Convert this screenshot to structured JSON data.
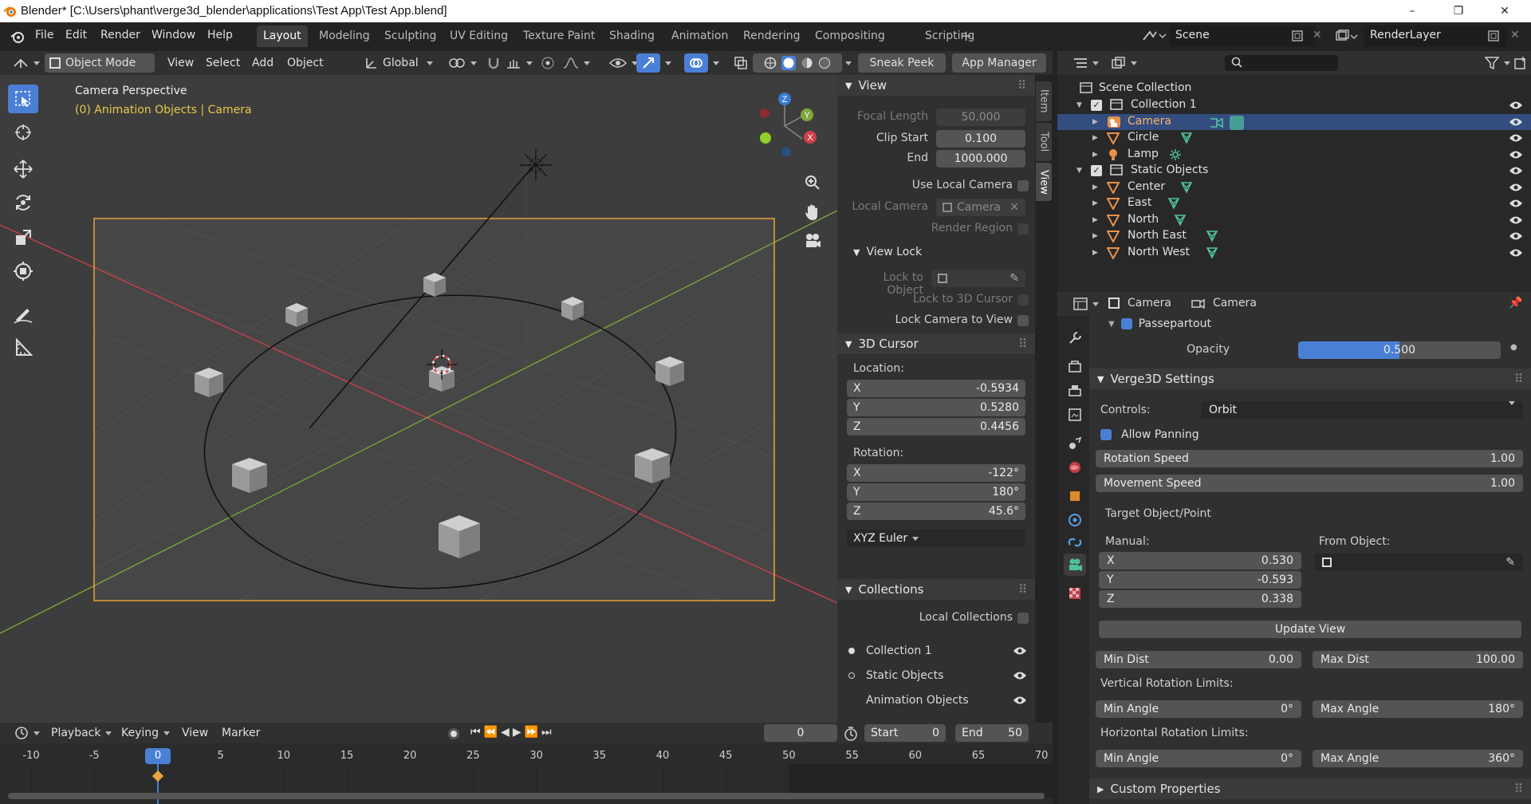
{
  "titlebar": {
    "title": "Blender* [C:\\Users\\phant\\verge3d_blender\\applications\\Test App\\Test App.blend]",
    "minimize": "–",
    "maximize": "❐",
    "close": "✕"
  },
  "menus": [
    "File",
    "Edit",
    "Render",
    "Window",
    "Help"
  ],
  "workspaces": [
    "Layout",
    "Modeling",
    "Sculpting",
    "UV Editing",
    "Texture Paint",
    "Shading",
    "Animation",
    "Rendering",
    "Compositing",
    "Scripting",
    "+"
  ],
  "active_workspace": "Layout",
  "scene": {
    "name": "Scene",
    "render_layer": "RenderLayer"
  },
  "viewport_header": {
    "mode": "Object Mode",
    "menus": [
      "View",
      "Select",
      "Add",
      "Object"
    ],
    "transform": "Global",
    "sneak_peek": "Sneak Peek",
    "app_manager": "App Manager"
  },
  "viewport": {
    "title": "Camera Perspective",
    "subtitle": "(0) Animation Objects | Camera",
    "gizmo": {
      "x": "X",
      "y": "Y",
      "z": "Z"
    }
  },
  "npanel": {
    "tabs": [
      "Item",
      "Tool",
      "View"
    ],
    "view": {
      "header": "View",
      "focal_length_label": "Focal Length",
      "focal_length": "50.000",
      "clip_start_label": "Clip Start",
      "clip_start": "0.100",
      "end_label": "End",
      "end": "1000.000",
      "use_local_camera": "Use Local Camera",
      "local_camera_label": "Local Camera",
      "local_camera": "Camera",
      "render_region": "Render Region"
    },
    "view_lock": {
      "header": "View Lock",
      "lock_to_object": "Lock to Object",
      "lock_to_cursor": "Lock to 3D Cursor",
      "lock_camera": "Lock Camera to View"
    },
    "cursor": {
      "header": "3D Cursor",
      "location_label": "Location:",
      "lx": "-0.5934",
      "ly": "0.5280",
      "lz": "0.4456",
      "rotation_label": "Rotation:",
      "rx": "-122°",
      "ry": "180°",
      "rz": "45.6°",
      "mode": "XYZ Euler",
      "x": "X",
      "y": "Y",
      "z": "Z"
    },
    "collections": {
      "header": "Collections",
      "local": "Local Collections",
      "items": [
        "Collection 1",
        "Static Objects",
        "Animation Objects"
      ]
    }
  },
  "outliner": {
    "root": "Scene Collection",
    "rows": [
      {
        "name": "Collection 1",
        "kind": "collection"
      },
      {
        "name": "Camera",
        "kind": "camera"
      },
      {
        "name": "Circle",
        "kind": "mesh"
      },
      {
        "name": "Lamp",
        "kind": "lamp"
      },
      {
        "name": "Static Objects",
        "kind": "collection"
      },
      {
        "name": "Center",
        "kind": "mesh"
      },
      {
        "name": "East",
        "kind": "mesh"
      },
      {
        "name": "North",
        "kind": "mesh"
      },
      {
        "name": "North East",
        "kind": "mesh"
      },
      {
        "name": "North West",
        "kind": "mesh"
      }
    ]
  },
  "properties": {
    "breadcrumb_object": "Camera",
    "breadcrumb_data": "Camera",
    "passepartout": "Passepartout",
    "opacity_label": "Opacity",
    "opacity": "0.500",
    "opacity_fraction": 0.5,
    "verge_header": "Verge3D Settings",
    "controls_label": "Controls:",
    "controls": "Orbit",
    "allow_panning": "Allow Panning",
    "rotation_speed_label": "Rotation Speed",
    "rotation_speed": "1.00",
    "movement_speed_label": "Movement Speed",
    "movement_speed": "1.00",
    "target_label": "Target Object/Point",
    "manual_label": "Manual:",
    "from_object_label": "From Object:",
    "tx": "0.530",
    "ty": "-0.593",
    "tz": "0.338",
    "update_view": "Update View",
    "min_dist_label": "Min Dist",
    "min_dist": "0.00",
    "max_dist_label": "Max Dist",
    "max_dist": "100.00",
    "vert_limits": "Vertical Rotation Limits:",
    "horiz_limits": "Horizontal Rotation Limits:",
    "min_angle_label": "Min Angle",
    "max_angle_label": "Max Angle",
    "v_min": "0°",
    "v_max": "180°",
    "h_min": "0°",
    "h_max": "360°",
    "custom_props": "Custom Properties"
  },
  "timeline": {
    "menus": [
      "Playback",
      "Keying",
      "View",
      "Marker"
    ],
    "current_frame": "0",
    "start_label": "Start",
    "start": "0",
    "end_label": "End",
    "end": "50",
    "ticks": [
      "-10",
      "-5",
      "0",
      "5",
      "10",
      "15",
      "20",
      "25",
      "30",
      "35",
      "40",
      "45",
      "50",
      "55",
      "60",
      "65",
      "70"
    ]
  },
  "colors": {
    "accent": "#4a7fd6",
    "selection": "#334d80",
    "camera_frame": "#e8a33d",
    "x_axis": "#d1404a",
    "y_axis": "#7fa83a"
  }
}
